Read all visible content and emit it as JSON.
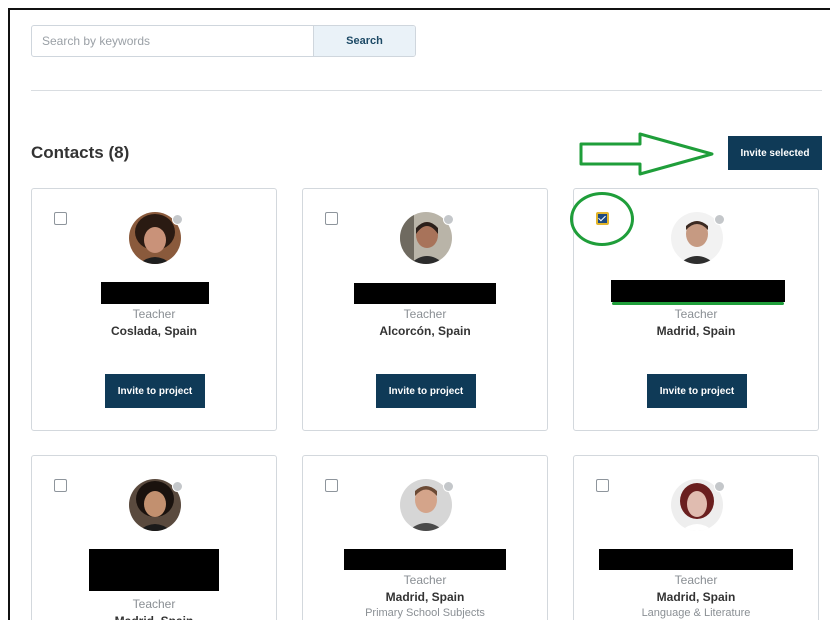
{
  "search": {
    "placeholder": "Search by keywords",
    "button_label": "Search"
  },
  "contacts": {
    "title": "Contacts (8)",
    "invite_selected_label": "Invite selected"
  },
  "cards": [
    {
      "role": "Teacher",
      "location": "Coslada, Spain",
      "subject": "",
      "checked": false,
      "invite_label": "Invite to project"
    },
    {
      "role": "Teacher",
      "location": "Alcorcón, Spain",
      "subject": "",
      "checked": false,
      "invite_label": "Invite to project"
    },
    {
      "role": "Teacher",
      "location": "Madrid, Spain",
      "subject": "",
      "checked": true,
      "invite_label": "Invite to project"
    },
    {
      "role": "Teacher",
      "location": "Madrid, Spain",
      "subject": "",
      "checked": false
    },
    {
      "role": "Teacher",
      "location": "Madrid, Spain",
      "subject": "Primary School Subjects",
      "checked": false
    },
    {
      "role": "Teacher",
      "location": "Madrid, Spain",
      "subject": "Language & Literature",
      "checked": false
    }
  ],
  "colors": {
    "primary_button": "#0f3a57",
    "annotation_green": "#1f9e3a",
    "checkbox_checked": "#1d4a80",
    "checkbox_highlight": "#e2b52d"
  }
}
